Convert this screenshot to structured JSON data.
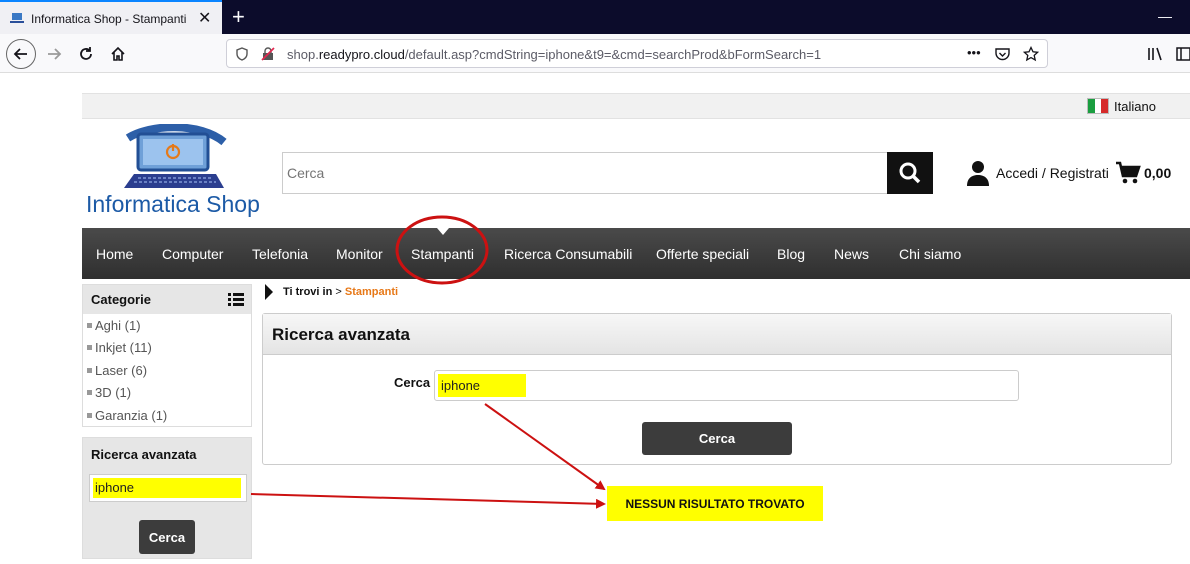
{
  "browser": {
    "tab_title": "Informatica Shop - Stampanti",
    "url_prefix": "shop.",
    "url_domain": "readypro.cloud",
    "url_rest": "/default.asp?cmdString=iphone&t9=&cmd=searchProd&bFormSearch=1",
    "url_menu_dots": "•••"
  },
  "header": {
    "language": "Italiano",
    "logo_text": "Informatica Shop",
    "search_placeholder": "Cerca",
    "account_label": "Accedi / Registrati",
    "cart_total": "0,00"
  },
  "menu": [
    "Home",
    "Computer",
    "Telefonia",
    "Monitor",
    "Stampanti",
    "Ricerca Consumabili",
    "Offerte speciali",
    "Blog",
    "News",
    "Chi siamo"
  ],
  "sidebar": {
    "categories_title": "Categorie",
    "categories": [
      "Aghi (1)",
      "Inkjet (11)",
      "Laser (6)",
      "3D (1)",
      "Garanzia (1)"
    ],
    "advanced_title": "Ricerca avanzata",
    "advanced_value": "iphone",
    "advanced_button": "Cerca"
  },
  "breadcrumb": {
    "prefix": "Ti trovi in",
    "separator": ">",
    "current": "Stampanti"
  },
  "main": {
    "panel_title": "Ricerca avanzata",
    "field_label": "Cerca",
    "field_value": "iphone",
    "button_label": "Cerca"
  },
  "annotation": {
    "message": "NESSUN RISULTATO TROVATO",
    "arrow_color": "#cc1111",
    "highlight_color": "#ffff00"
  }
}
